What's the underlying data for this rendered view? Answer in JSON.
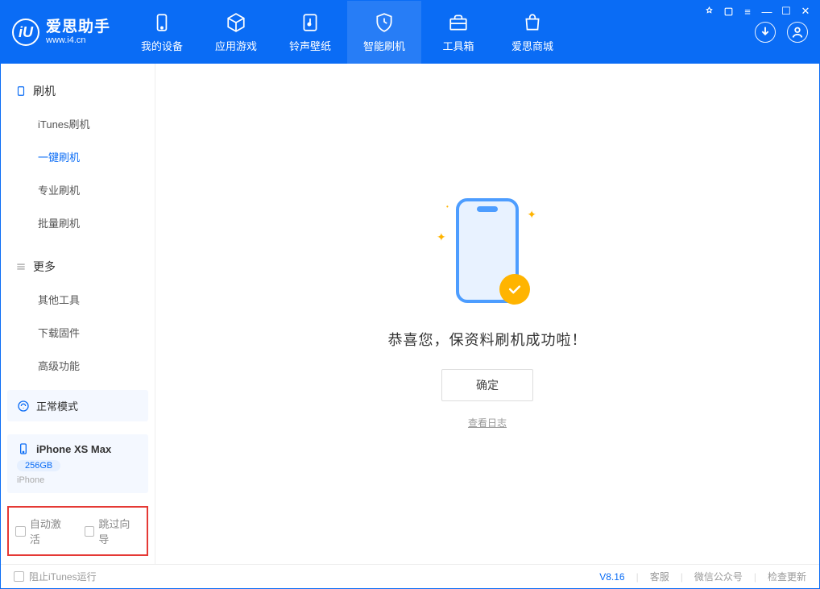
{
  "app": {
    "name": "爱思助手",
    "url": "www.i4.cn"
  },
  "nav": {
    "tabs": [
      {
        "label": "我的设备"
      },
      {
        "label": "应用游戏"
      },
      {
        "label": "铃声壁纸"
      },
      {
        "label": "智能刷机"
      },
      {
        "label": "工具箱"
      },
      {
        "label": "爱思商城"
      }
    ],
    "activeIndex": 3
  },
  "sidebar": {
    "group1": {
      "title": "刷机",
      "items": [
        {
          "label": "iTunes刷机"
        },
        {
          "label": "一键刷机"
        },
        {
          "label": "专业刷机"
        },
        {
          "label": "批量刷机"
        }
      ],
      "activeIndex": 1
    },
    "group2": {
      "title": "更多",
      "items": [
        {
          "label": "其他工具"
        },
        {
          "label": "下载固件"
        },
        {
          "label": "高级功能"
        }
      ]
    },
    "mode": {
      "label": "正常模式"
    },
    "device": {
      "name": "iPhone XS Max",
      "storage": "256GB",
      "type": "iPhone"
    },
    "options": {
      "autoActivate": "自动激活",
      "skipGuide": "跳过向导"
    }
  },
  "main": {
    "successMsg": "恭喜您，保资料刷机成功啦！",
    "okBtn": "确定",
    "viewLog": "查看日志"
  },
  "statusbar": {
    "blockItunes": "阻止iTunes运行",
    "version": "V8.16",
    "support": "客服",
    "wechat": "微信公众号",
    "update": "检查更新"
  }
}
